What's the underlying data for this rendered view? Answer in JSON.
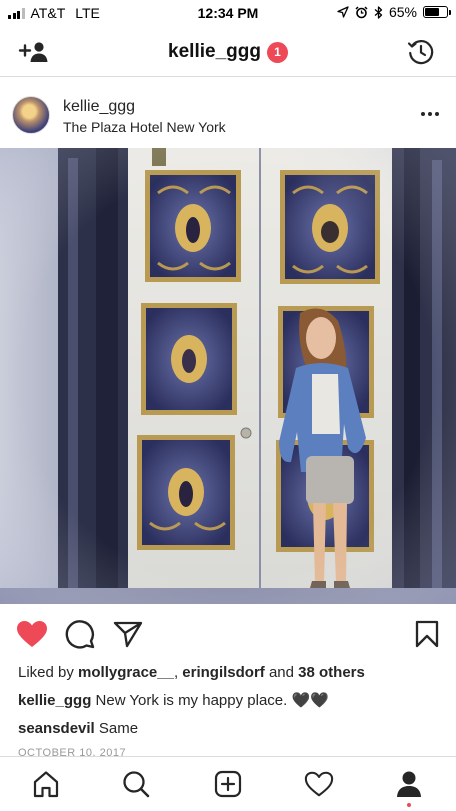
{
  "status_bar": {
    "carrier": "AT&T",
    "network": "LTE",
    "time": "12:34 PM",
    "battery": "65%",
    "battery_level": 0.65
  },
  "header": {
    "title": "kellie_ggg",
    "badge_count": "1"
  },
  "post": {
    "username": "kellie_ggg",
    "location": "The Plaza Hotel New York",
    "likes": {
      "prefix": "Liked by ",
      "user1": "mollygrace__",
      "sep": ", ",
      "user2": "eringilsdorf",
      "mid": " and ",
      "others": "38 others"
    },
    "caption": {
      "username": "kellie_ggg",
      "text": " New York is my happy place. 🖤🖤"
    },
    "comment": {
      "username": "seansdevil",
      "text": " Same"
    },
    "date": "OCTOBER 10, 2017"
  },
  "colors": {
    "like_red": "#ed4956",
    "badge_red": "#ed4956",
    "text": "#262626",
    "divider": "#dbdbdb"
  },
  "icons": {
    "header_left": "add-user-icon",
    "header_right": "history-icon",
    "more": "more-options-icon",
    "like": "heart-filled-icon",
    "comment": "comment-icon",
    "share": "send-icon",
    "save": "bookmark-icon",
    "tabs": [
      "home-icon",
      "search-icon",
      "add-post-icon",
      "activity-heart-icon",
      "profile-icon"
    ]
  }
}
